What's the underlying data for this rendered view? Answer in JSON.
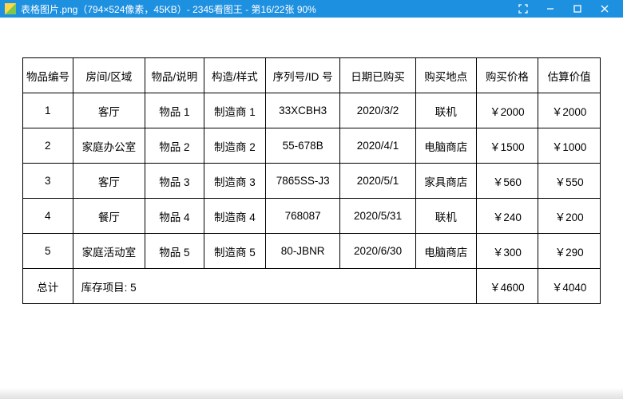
{
  "titlebar": {
    "text": "表格图片.png（794×524像素，45KB）- 2345看图王 - 第16/22张 90%"
  },
  "table": {
    "headers": {
      "id": "物品编号",
      "room": "房间/区域",
      "item": "物品/说明",
      "make": "构造/样式",
      "sn": "序列号/ID 号",
      "date": "日期已购买",
      "loc": "购买地点",
      "price": "购买价格",
      "value": "估算价值"
    },
    "rows": [
      {
        "id": "1",
        "room": "客厅",
        "item": "物品 1",
        "make": "制造商 1",
        "sn": "33XCBH3",
        "date": "2020/3/2",
        "loc": "联机",
        "price": "￥2000",
        "value": "￥2000"
      },
      {
        "id": "2",
        "room": "家庭办公室",
        "item": "物品 2",
        "make": "制造商 2",
        "sn": "55-678B",
        "date": "2020/4/1",
        "loc": "电脑商店",
        "price": "￥1500",
        "value": "￥1000"
      },
      {
        "id": "3",
        "room": "客厅",
        "item": "物品 3",
        "make": "制造商 3",
        "sn": "7865SS-J3",
        "date": "2020/5/1",
        "loc": "家具商店",
        "price": "￥560",
        "value": "￥550"
      },
      {
        "id": "4",
        "room": "餐厅",
        "item": "物品 4",
        "make": "制造商 4",
        "sn": "768087",
        "date": "2020/5/31",
        "loc": "联机",
        "price": "￥240",
        "value": "￥200"
      },
      {
        "id": "5",
        "room": "家庭活动室",
        "item": "物品 5",
        "make": "制造商 5",
        "sn": "80-JBNR",
        "date": "2020/6/30",
        "loc": "电脑商店",
        "price": "￥300",
        "value": "￥290"
      }
    ],
    "summary": {
      "label": "总计",
      "count": "库存项目: 5",
      "price_total": "￥4600",
      "value_total": "￥4040"
    }
  }
}
